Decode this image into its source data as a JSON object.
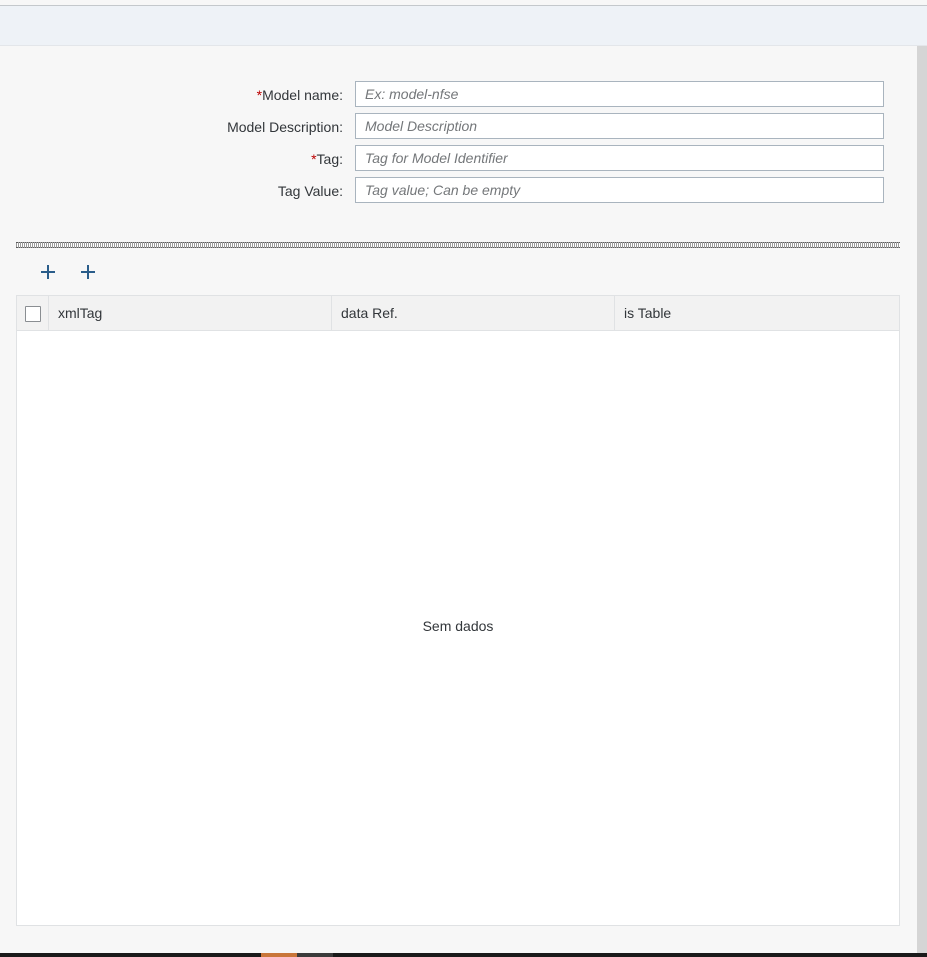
{
  "form": {
    "model_name": {
      "label": "Model name:",
      "required_mark": "*",
      "placeholder": "Ex: model-nfse",
      "value": ""
    },
    "model_description": {
      "label": "Model Description:",
      "placeholder": "Model Description",
      "value": ""
    },
    "tag": {
      "label": "Tag:",
      "required_mark": "*",
      "placeholder": "Tag for Model Identifier",
      "value": ""
    },
    "tag_value": {
      "label": "Tag Value:",
      "placeholder": "Tag value; Can be empty",
      "value": ""
    }
  },
  "toolbar": {
    "buttons": [
      {
        "icon": "plus-icon"
      },
      {
        "icon": "plus-icon"
      }
    ]
  },
  "table": {
    "columns": [
      "xmlTag",
      "data Ref.",
      "is Table"
    ],
    "rows": [],
    "no_data_text": "Sem dados"
  },
  "colors": {
    "required": "#bb0000",
    "icon": "#2a5d8a",
    "header_bg": "#eef2f7"
  }
}
